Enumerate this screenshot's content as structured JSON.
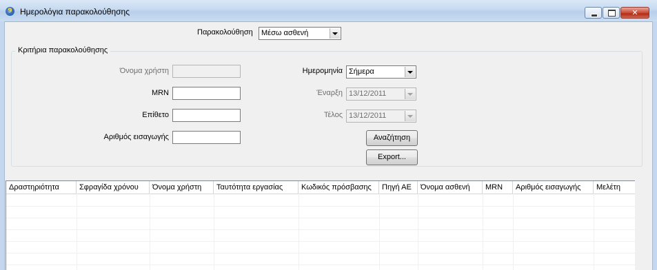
{
  "window": {
    "title": "Ημερολόγια παρακολούθησης",
    "icon_glyph": "9",
    "controls": {
      "minimize": "minimize-icon",
      "maximize": "maximize-icon",
      "close": "close-icon",
      "close_glyph": "✕"
    }
  },
  "tracking": {
    "label": "Παρακολούθηση",
    "value": "Μέσω ασθενή"
  },
  "criteria": {
    "group_title": "Κριτήρια παρακολούθησης",
    "username_label": "Όνομα χρήστη",
    "mrn_label": "MRN",
    "surname_label": "Επίθετο",
    "admission_label": "Αριθμός εισαγωγής",
    "date_label": "Ημερομηνία",
    "date_value": "Σήμερα",
    "start_label": "Έναρξη",
    "start_value": "13/12/2011",
    "end_label": "Τέλος",
    "end_value": "13/12/2011",
    "search_button": "Αναζήτηση",
    "export_button": "Export..."
  },
  "grid": {
    "columns": [
      "Δραστηριότητα",
      "Σφραγίδα χρόνου",
      "Όνομα χρήστη",
      "Ταυτότητα εργασίας",
      "Κωδικός πρόσβασης",
      "Πηγή ΑΕ",
      "Όνομα ασθενή",
      "MRN",
      "Αριθμός εισαγωγής",
      "Μελέτη"
    ],
    "rows": []
  }
}
